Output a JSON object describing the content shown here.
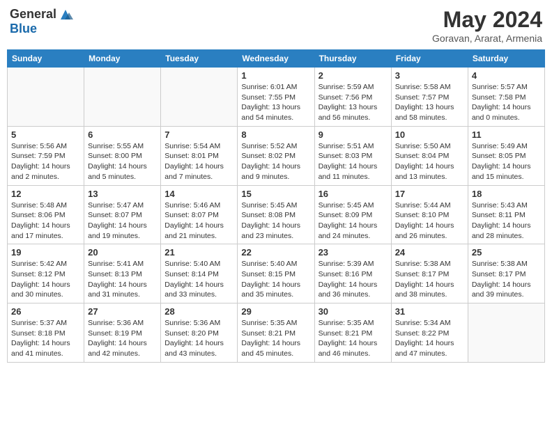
{
  "header": {
    "logo_general": "General",
    "logo_blue": "Blue",
    "title": "May 2024",
    "subtitle": "Goravan, Ararat, Armenia"
  },
  "days_of_week": [
    "Sunday",
    "Monday",
    "Tuesday",
    "Wednesday",
    "Thursday",
    "Friday",
    "Saturday"
  ],
  "weeks": [
    [
      {
        "day": "",
        "info": ""
      },
      {
        "day": "",
        "info": ""
      },
      {
        "day": "",
        "info": ""
      },
      {
        "day": "1",
        "sunrise": "6:01 AM",
        "sunset": "7:55 PM",
        "daylight": "13 hours and 54 minutes."
      },
      {
        "day": "2",
        "sunrise": "5:59 AM",
        "sunset": "7:56 PM",
        "daylight": "13 hours and 56 minutes."
      },
      {
        "day": "3",
        "sunrise": "5:58 AM",
        "sunset": "7:57 PM",
        "daylight": "13 hours and 58 minutes."
      },
      {
        "day": "4",
        "sunrise": "5:57 AM",
        "sunset": "7:58 PM",
        "daylight": "14 hours and 0 minutes."
      }
    ],
    [
      {
        "day": "5",
        "sunrise": "5:56 AM",
        "sunset": "7:59 PM",
        "daylight": "14 hours and 2 minutes."
      },
      {
        "day": "6",
        "sunrise": "5:55 AM",
        "sunset": "8:00 PM",
        "daylight": "14 hours and 5 minutes."
      },
      {
        "day": "7",
        "sunrise": "5:54 AM",
        "sunset": "8:01 PM",
        "daylight": "14 hours and 7 minutes."
      },
      {
        "day": "8",
        "sunrise": "5:52 AM",
        "sunset": "8:02 PM",
        "daylight": "14 hours and 9 minutes."
      },
      {
        "day": "9",
        "sunrise": "5:51 AM",
        "sunset": "8:03 PM",
        "daylight": "14 hours and 11 minutes."
      },
      {
        "day": "10",
        "sunrise": "5:50 AM",
        "sunset": "8:04 PM",
        "daylight": "14 hours and 13 minutes."
      },
      {
        "day": "11",
        "sunrise": "5:49 AM",
        "sunset": "8:05 PM",
        "daylight": "14 hours and 15 minutes."
      }
    ],
    [
      {
        "day": "12",
        "sunrise": "5:48 AM",
        "sunset": "8:06 PM",
        "daylight": "14 hours and 17 minutes."
      },
      {
        "day": "13",
        "sunrise": "5:47 AM",
        "sunset": "8:07 PM",
        "daylight": "14 hours and 19 minutes."
      },
      {
        "day": "14",
        "sunrise": "5:46 AM",
        "sunset": "8:07 PM",
        "daylight": "14 hours and 21 minutes."
      },
      {
        "day": "15",
        "sunrise": "5:45 AM",
        "sunset": "8:08 PM",
        "daylight": "14 hours and 23 minutes."
      },
      {
        "day": "16",
        "sunrise": "5:45 AM",
        "sunset": "8:09 PM",
        "daylight": "14 hours and 24 minutes."
      },
      {
        "day": "17",
        "sunrise": "5:44 AM",
        "sunset": "8:10 PM",
        "daylight": "14 hours and 26 minutes."
      },
      {
        "day": "18",
        "sunrise": "5:43 AM",
        "sunset": "8:11 PM",
        "daylight": "14 hours and 28 minutes."
      }
    ],
    [
      {
        "day": "19",
        "sunrise": "5:42 AM",
        "sunset": "8:12 PM",
        "daylight": "14 hours and 30 minutes."
      },
      {
        "day": "20",
        "sunrise": "5:41 AM",
        "sunset": "8:13 PM",
        "daylight": "14 hours and 31 minutes."
      },
      {
        "day": "21",
        "sunrise": "5:40 AM",
        "sunset": "8:14 PM",
        "daylight": "14 hours and 33 minutes."
      },
      {
        "day": "22",
        "sunrise": "5:40 AM",
        "sunset": "8:15 PM",
        "daylight": "14 hours and 35 minutes."
      },
      {
        "day": "23",
        "sunrise": "5:39 AM",
        "sunset": "8:16 PM",
        "daylight": "14 hours and 36 minutes."
      },
      {
        "day": "24",
        "sunrise": "5:38 AM",
        "sunset": "8:17 PM",
        "daylight": "14 hours and 38 minutes."
      },
      {
        "day": "25",
        "sunrise": "5:38 AM",
        "sunset": "8:17 PM",
        "daylight": "14 hours and 39 minutes."
      }
    ],
    [
      {
        "day": "26",
        "sunrise": "5:37 AM",
        "sunset": "8:18 PM",
        "daylight": "14 hours and 41 minutes."
      },
      {
        "day": "27",
        "sunrise": "5:36 AM",
        "sunset": "8:19 PM",
        "daylight": "14 hours and 42 minutes."
      },
      {
        "day": "28",
        "sunrise": "5:36 AM",
        "sunset": "8:20 PM",
        "daylight": "14 hours and 43 minutes."
      },
      {
        "day": "29",
        "sunrise": "5:35 AM",
        "sunset": "8:21 PM",
        "daylight": "14 hours and 45 minutes."
      },
      {
        "day": "30",
        "sunrise": "5:35 AM",
        "sunset": "8:21 PM",
        "daylight": "14 hours and 46 minutes."
      },
      {
        "day": "31",
        "sunrise": "5:34 AM",
        "sunset": "8:22 PM",
        "daylight": "14 hours and 47 minutes."
      },
      {
        "day": "",
        "info": ""
      }
    ]
  ]
}
